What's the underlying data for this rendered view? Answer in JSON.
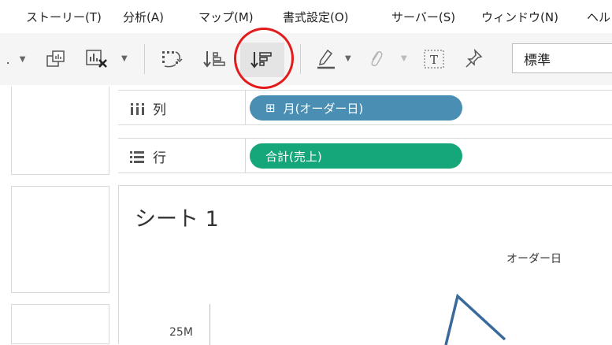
{
  "menu": [
    "ストーリー(T)",
    "分析(A)",
    "マップ(M)",
    "書式設定(O)",
    "サーバー(S)",
    "ウィンドウ(N)",
    "ヘル"
  ],
  "toolbar": {
    "zoom_value": "標準"
  },
  "shelves": {
    "columns": {
      "label": "列",
      "pill": "月(オーダー日)",
      "pill_prefix": "⊞",
      "color": "#4a8eb3"
    },
    "rows": {
      "label": "行",
      "pill": "合計(売上)",
      "color": "#15a77a"
    }
  },
  "view": {
    "sheet_title": "シート 1",
    "header": "オーダー日",
    "y_tick": "25M",
    "line_color": "#3a6a9b"
  }
}
